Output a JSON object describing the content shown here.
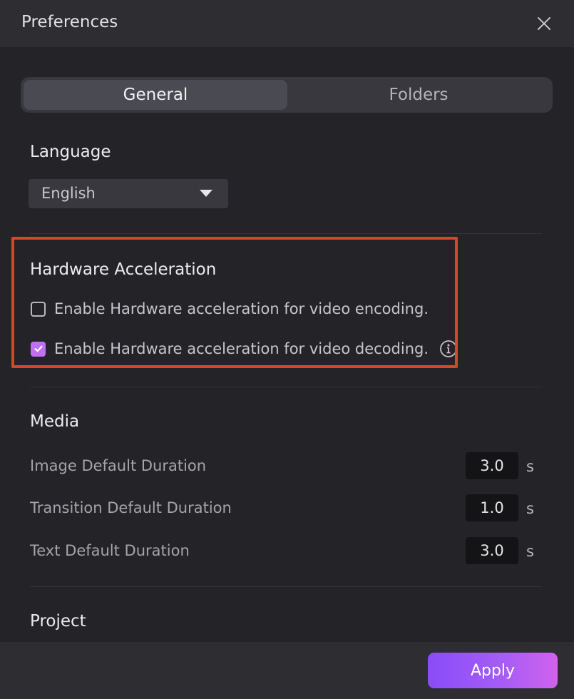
{
  "dialog": {
    "title": "Preferences",
    "close_icon": "close-icon"
  },
  "tabs": [
    {
      "label": "General",
      "active": true
    },
    {
      "label": "Folders",
      "active": false
    }
  ],
  "language": {
    "heading": "Language",
    "selected": "English",
    "caret_icon": "caret-down-icon"
  },
  "hardware": {
    "heading": "Hardware Acceleration",
    "options": [
      {
        "label": "Enable Hardware acceleration for video encoding.",
        "checked": false
      },
      {
        "label": "Enable Hardware acceleration for video decoding.",
        "checked": true,
        "info_icon": "info-icon"
      }
    ],
    "highlight_color": "#d9452c"
  },
  "media": {
    "heading": "Media",
    "rows": [
      {
        "label": "Image Default Duration",
        "value": "3.0",
        "unit": "s"
      },
      {
        "label": "Transition Default Duration",
        "value": "1.0",
        "unit": "s"
      },
      {
        "label": "Text Default Duration",
        "value": "3.0",
        "unit": "s"
      }
    ]
  },
  "project": {
    "heading": "Project"
  },
  "footer": {
    "apply_label": "Apply",
    "accent_from": "#8a4cf8",
    "accent_to": "#d162ee"
  },
  "colors": {
    "background": "#232328",
    "titlebar": "#2d2d32",
    "checkbox_accent": "#c070f0"
  }
}
